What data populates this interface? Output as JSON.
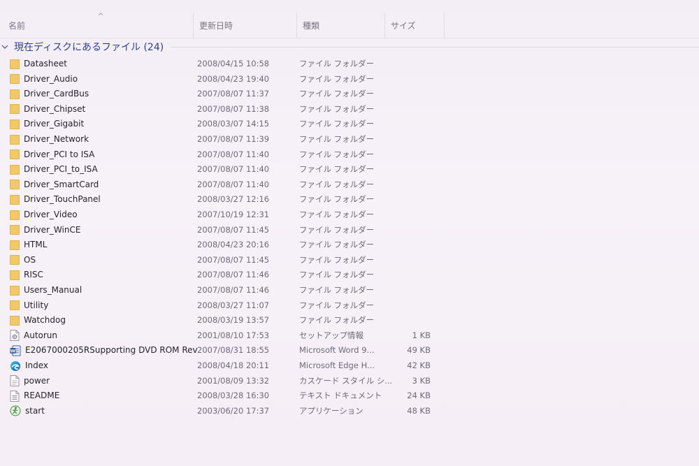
{
  "columns": {
    "name": "名前",
    "date": "更新日時",
    "type": "種類",
    "size": "サイズ"
  },
  "group": {
    "label": "現在ディスクにあるファイル (24)"
  },
  "files": [
    {
      "name": "Datasheet",
      "date": "2008/04/15 10:58",
      "type": "ファイル フォルダー",
      "size": "",
      "icon": "folder-icon"
    },
    {
      "name": "Driver_Audio",
      "date": "2008/04/23 19:40",
      "type": "ファイル フォルダー",
      "size": "",
      "icon": "folder-icon"
    },
    {
      "name": "Driver_CardBus",
      "date": "2007/08/07 11:37",
      "type": "ファイル フォルダー",
      "size": "",
      "icon": "folder-icon"
    },
    {
      "name": "Driver_Chipset",
      "date": "2007/08/07 11:38",
      "type": "ファイル フォルダー",
      "size": "",
      "icon": "folder-icon"
    },
    {
      "name": "Driver_Gigabit",
      "date": "2008/03/07 14:15",
      "type": "ファイル フォルダー",
      "size": "",
      "icon": "folder-icon"
    },
    {
      "name": "Driver_Network",
      "date": "2007/08/07 11:39",
      "type": "ファイル フォルダー",
      "size": "",
      "icon": "folder-icon"
    },
    {
      "name": "Driver_PCI to ISA",
      "date": "2007/08/07 11:40",
      "type": "ファイル フォルダー",
      "size": "",
      "icon": "folder-icon"
    },
    {
      "name": "Driver_PCI_to_ISA",
      "date": "2007/08/07 11:40",
      "type": "ファイル フォルダー",
      "size": "",
      "icon": "folder-icon"
    },
    {
      "name": "Driver_SmartCard",
      "date": "2007/08/07 11:40",
      "type": "ファイル フォルダー",
      "size": "",
      "icon": "folder-icon"
    },
    {
      "name": "Driver_TouchPanel",
      "date": "2008/03/27 12:16",
      "type": "ファイル フォルダー",
      "size": "",
      "icon": "folder-icon"
    },
    {
      "name": "Driver_Video",
      "date": "2007/10/19 12:31",
      "type": "ファイル フォルダー",
      "size": "",
      "icon": "folder-icon"
    },
    {
      "name": "Driver_WinCE",
      "date": "2007/08/07 11:45",
      "type": "ファイル フォルダー",
      "size": "",
      "icon": "folder-icon"
    },
    {
      "name": "HTML",
      "date": "2008/04/23 20:16",
      "type": "ファイル フォルダー",
      "size": "",
      "icon": "folder-icon"
    },
    {
      "name": "OS",
      "date": "2007/08/07 11:45",
      "type": "ファイル フォルダー",
      "size": "",
      "icon": "folder-icon"
    },
    {
      "name": "RISC",
      "date": "2007/08/07 11:46",
      "type": "ファイル フォルダー",
      "size": "",
      "icon": "folder-icon"
    },
    {
      "name": "Users_Manual",
      "date": "2007/08/07 11:46",
      "type": "ファイル フォルダー",
      "size": "",
      "icon": "folder-icon"
    },
    {
      "name": "Utility",
      "date": "2008/03/27 11:07",
      "type": "ファイル フォルダー",
      "size": "",
      "icon": "folder-icon"
    },
    {
      "name": "Watchdog",
      "date": "2008/03/19 13:57",
      "type": "ファイル フォルダー",
      "size": "",
      "icon": "folder-icon"
    },
    {
      "name": "Autorun",
      "date": "2001/08/10 17:53",
      "type": "セットアップ情報",
      "size": "1 KB",
      "icon": "settings-file-icon"
    },
    {
      "name": "E2067000205RSupporting DVD ROM Rev",
      "date": "2007/08/31 18:55",
      "type": "Microsoft Word 9...",
      "size": "49 KB",
      "icon": "word-document-icon"
    },
    {
      "name": "Index",
      "date": "2008/04/18 20:11",
      "type": "Microsoft Edge H...",
      "size": "42 KB",
      "icon": "edge-browser-icon"
    },
    {
      "name": "power",
      "date": "2001/08/09 13:32",
      "type": "カスケード スタイル シ...",
      "size": "3 KB",
      "icon": "stylesheet-file-icon"
    },
    {
      "name": "README",
      "date": "2008/03/28 16:30",
      "type": "テキスト ドキュメント",
      "size": "24 KB",
      "icon": "text-document-icon"
    },
    {
      "name": "start",
      "date": "2003/06/20 17:37",
      "type": "アプリケーション",
      "size": "48 KB",
      "icon": "application-icon"
    }
  ],
  "colors": {
    "background": "#f6f0f8",
    "group_label": "#2f3f8f",
    "folder": "#f2c96a",
    "word_blue": "#2b579a",
    "edge_blue": "#1b8fd8",
    "app_green": "#3f8f3a"
  }
}
